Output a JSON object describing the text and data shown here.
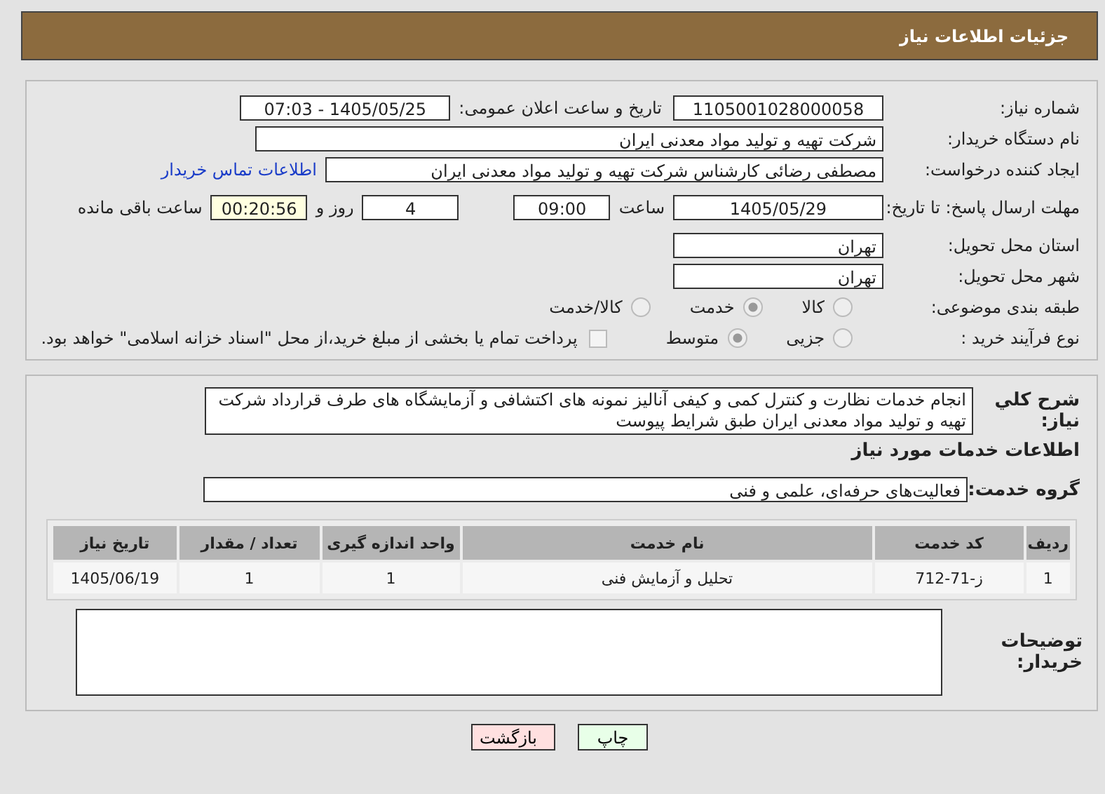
{
  "header": {
    "title": "جزئیات اطلاعات نیاز"
  },
  "need_number": {
    "label": "شماره نیاز:",
    "value": "1105001028000058"
  },
  "announce": {
    "label": "تاریخ و ساعت اعلان عمومی:",
    "value": "1405/05/25 - 07:03"
  },
  "buyer": {
    "label": "نام دستگاه خریدار:",
    "value": "شرکت تهیه و تولید مواد معدنی ایران"
  },
  "creator": {
    "label": "ایجاد کننده درخواست:",
    "value": "مصطفی رضائی کارشناس شرکت تهیه و تولید مواد معدنی ایران",
    "link": "اطلاعات تماس خریدار"
  },
  "deadline": {
    "label": "مهلت ارسال پاسخ: تا تاریخ:",
    "date": "1405/05/29",
    "time_label": "ساعت",
    "time": "09:00",
    "days": "4",
    "days_label": "روز و",
    "remaining": "00:20:56",
    "remaining_label": "ساعت باقی مانده"
  },
  "province": {
    "label": "استان محل تحویل:",
    "value": "تهران"
  },
  "city": {
    "label": "شهر محل تحویل:",
    "value": "تهران"
  },
  "category": {
    "label": "طبقه بندی موضوعی:",
    "options": [
      {
        "label": "کالا",
        "selected": false
      },
      {
        "label": "خدمت",
        "selected": true
      },
      {
        "label": "کالا/خدمت",
        "selected": false
      }
    ]
  },
  "process": {
    "label": "نوع فرآیند خرید :",
    "options": [
      {
        "label": "جزیی",
        "selected": false
      },
      {
        "label": "متوسط",
        "selected": true
      }
    ],
    "payment": {
      "checked": false,
      "label": "پرداخت تمام یا بخشی از مبلغ خرید،از محل \"اسناد خزانه اسلامی\" خواهد بود."
    }
  },
  "description": {
    "label": "شرح کلي نياز:",
    "value": "انجام خدمات نظارت و کنترل کمی و کیفی آنالیز نمونه های اکتشافی و آزمایشگاه های طرف قرارداد شرکت تهیه و تولید مواد معدنی ایران طبق شرایط پیوست"
  },
  "services_title": "اطلاعات خدمات مورد نیاز",
  "service_group": {
    "label": "گروه خدمت:",
    "value": "فعالیت‌های حرفه‌ای، علمی و فنی"
  },
  "table": {
    "columns": [
      "ردیف",
      "کد خدمت",
      "نام خدمت",
      "واحد اندازه گیری",
      "تعداد / مقدار",
      "تاریخ نیاز"
    ],
    "rows": [
      [
        "1",
        "ز-71-712",
        "تحلیل و آزمایش فنی",
        "1",
        "1",
        "1405/06/19"
      ]
    ]
  },
  "buyer_notes": {
    "label": "توضیحات خریدار:"
  },
  "buttons": [
    {
      "label": "چاپ",
      "kind": "print"
    },
    {
      "label": "بازگشت",
      "kind": "back"
    }
  ]
}
